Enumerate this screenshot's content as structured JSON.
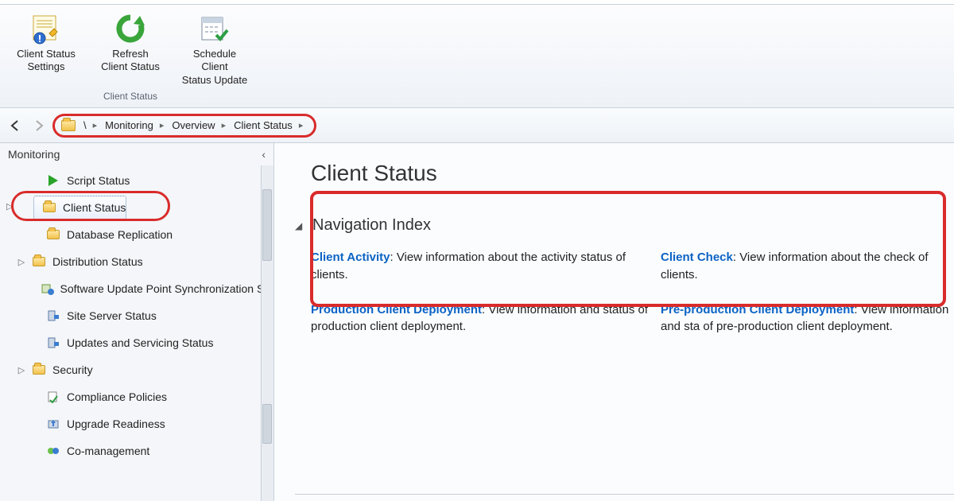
{
  "ribbon": {
    "group_label": "Client Status",
    "buttons": [
      {
        "label_line1": "Client Status",
        "label_line2": "Settings"
      },
      {
        "label_line1": "Refresh",
        "label_line2": "Client Status"
      },
      {
        "label_line1": "Schedule Client",
        "label_line2": "Status Update"
      }
    ]
  },
  "breadcrumb": {
    "root": "\\",
    "items": [
      "Monitoring",
      "Overview",
      "Client Status"
    ]
  },
  "tree": {
    "header": "Monitoring",
    "nodes": [
      {
        "label": "Script Status",
        "icon": "play",
        "expandable": false
      },
      {
        "label": "Client Status",
        "icon": "folder",
        "expandable": true,
        "selected": true
      },
      {
        "label": "Database Replication",
        "icon": "folder-db",
        "expandable": false
      },
      {
        "label": "Distribution Status",
        "icon": "folder",
        "expandable": true
      },
      {
        "label": "Software Update Point Synchronization Sta",
        "icon": "sync",
        "expandable": false
      },
      {
        "label": "Site Server Status",
        "icon": "server",
        "expandable": false
      },
      {
        "label": "Updates and Servicing Status",
        "icon": "server",
        "expandable": false
      },
      {
        "label": "Security",
        "icon": "folder",
        "expandable": true
      },
      {
        "label": "Compliance Policies",
        "icon": "compliance",
        "expandable": false
      },
      {
        "label": "Upgrade Readiness",
        "icon": "upgrade",
        "expandable": false
      },
      {
        "label": "Co-management",
        "icon": "comanage",
        "expandable": false
      }
    ]
  },
  "content": {
    "title": "Client Status",
    "section": "Navigation Index",
    "nav_items": [
      {
        "link": "Client Activity",
        "desc": "View information about the activity status of clients."
      },
      {
        "link": "Client Check",
        "desc": "View information about the check of clients."
      },
      {
        "link": "Production Client Deployment",
        "desc": "View information and status of production client deployment."
      },
      {
        "link": "Pre-production Client Deployment",
        "desc": "View information and sta of pre-production client deployment."
      }
    ]
  }
}
